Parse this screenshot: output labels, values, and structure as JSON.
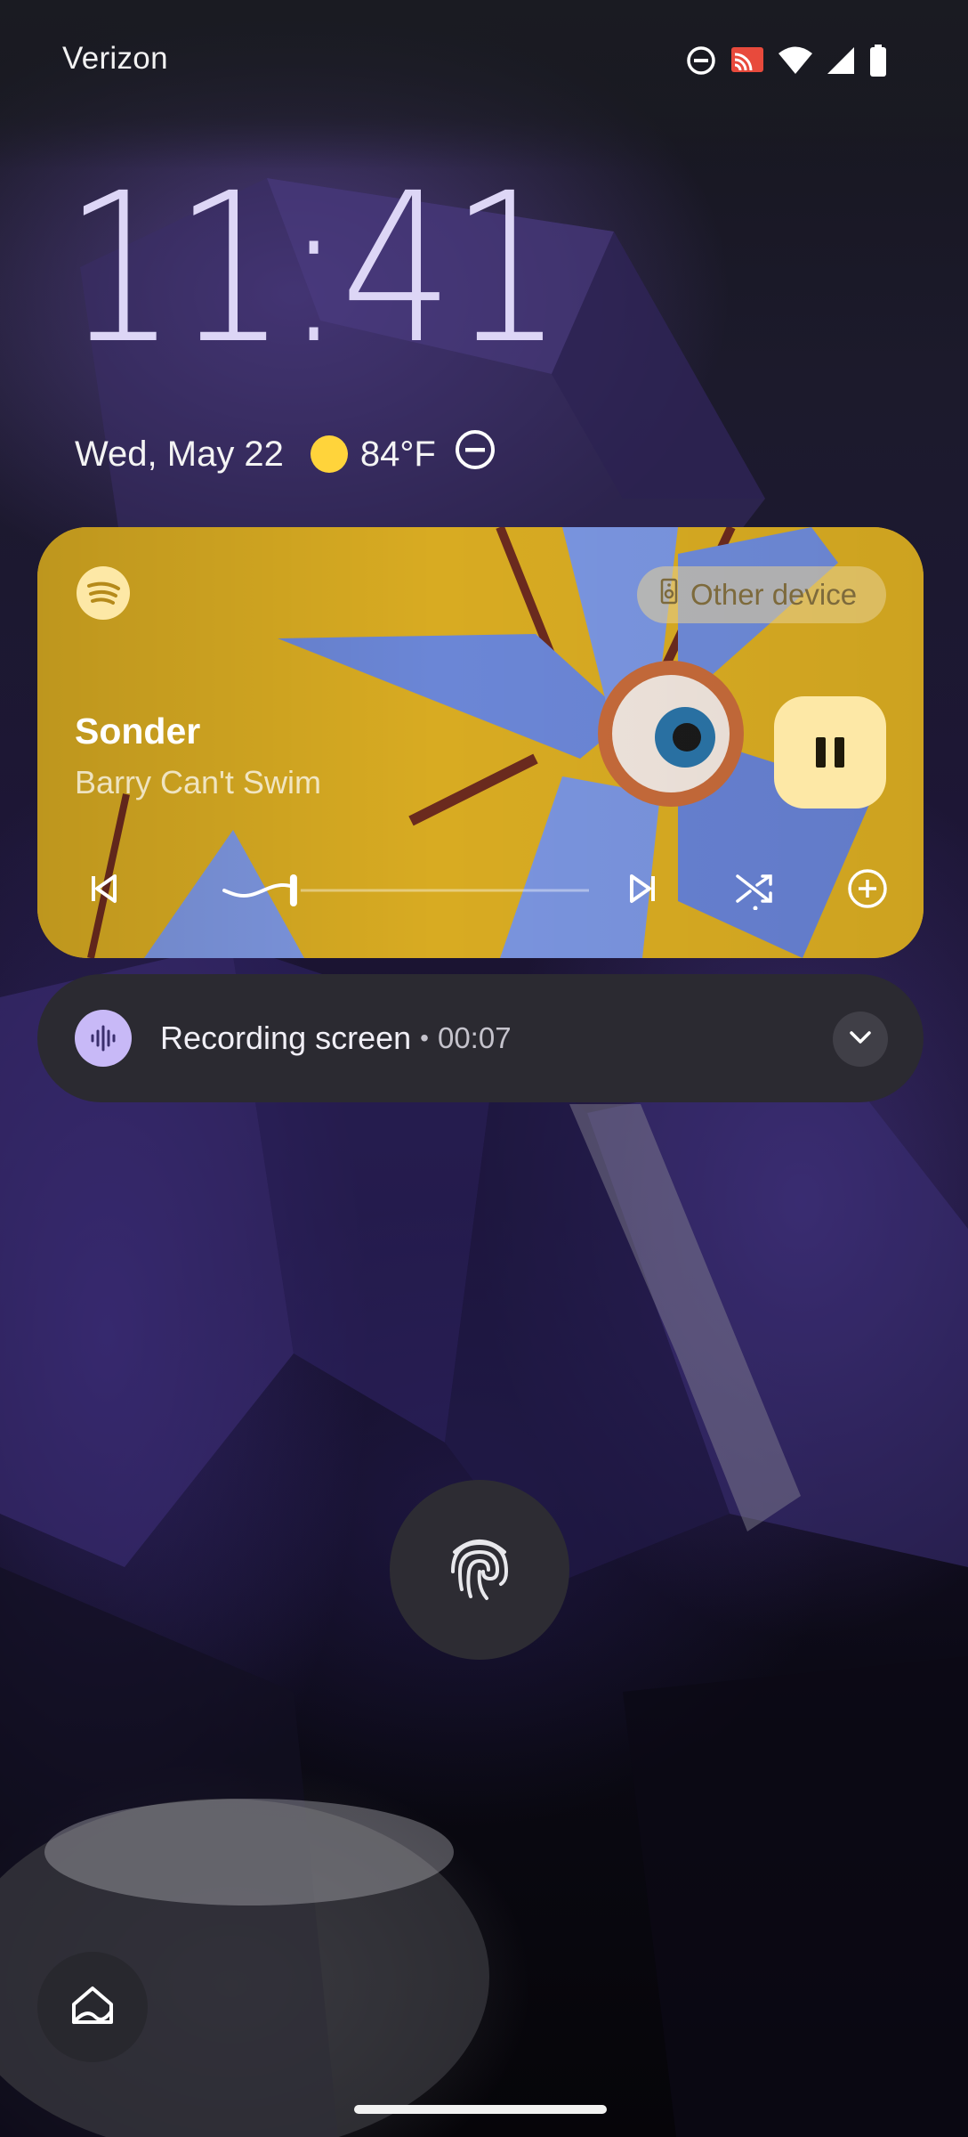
{
  "status_bar": {
    "carrier": "Verizon",
    "icons": [
      "do-not-disturb-icon",
      "cast-icon",
      "wifi-icon",
      "cellular-signal-icon",
      "battery-icon"
    ]
  },
  "lock_screen": {
    "time": "11:41",
    "date": "Wed, May 22",
    "weather": {
      "icon": "sun-icon",
      "temperature": "84°F"
    },
    "dnd_icon": "do-not-disturb-icon"
  },
  "media_player": {
    "app_icon": "spotify-icon",
    "output_device": "Other device",
    "title": "Sonder",
    "artist": "Barry Can't Swim",
    "progress": 0.19,
    "controls": [
      "previous-icon",
      "pause-icon",
      "next-icon",
      "shuffle-icon",
      "add-icon"
    ],
    "accent_color": "#fde8a6"
  },
  "notification": {
    "icon": "sound-wave-icon",
    "title": "Recording screen",
    "separator": "•",
    "elapsed": "00:07",
    "expand_icon": "chevron-down-icon"
  },
  "bottom": {
    "fingerprint_icon": "fingerprint-icon",
    "shortcut_icon": "home-icon"
  }
}
